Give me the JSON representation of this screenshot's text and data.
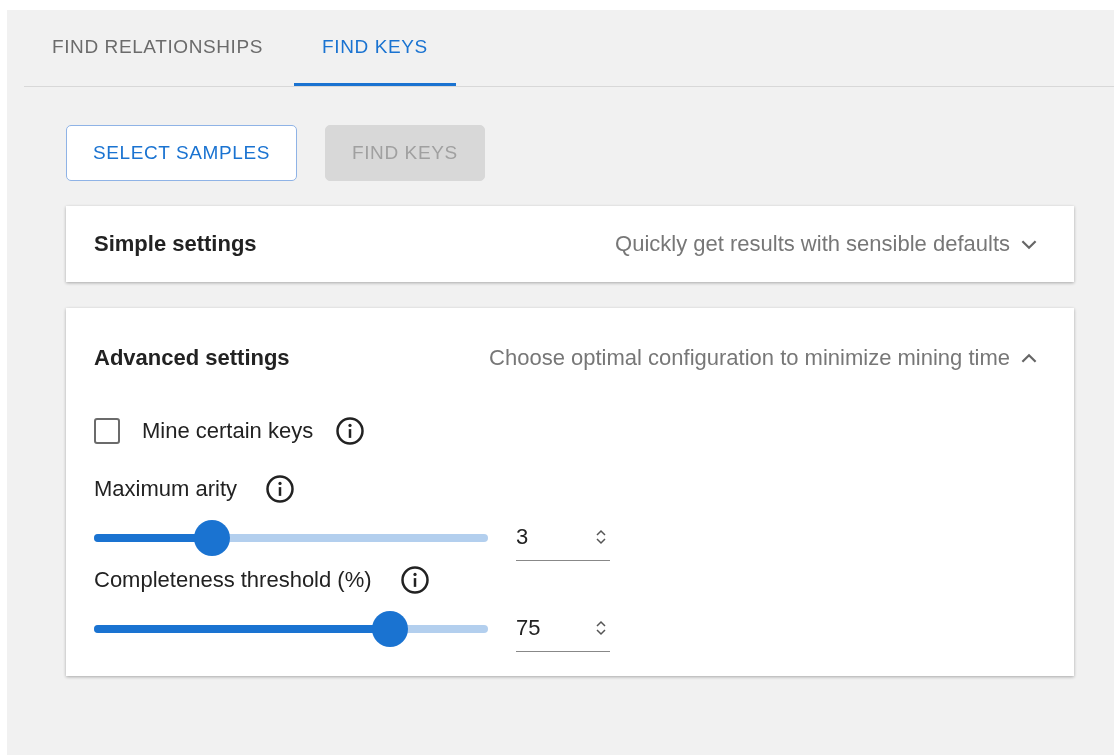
{
  "tabs": [
    {
      "label": "FIND RELATIONSHIPS",
      "selected": false
    },
    {
      "label": "FIND KEYS",
      "selected": true
    }
  ],
  "actions": [
    {
      "label": "SELECT SAMPLES",
      "disabled": false
    },
    {
      "label": "FIND KEYS",
      "disabled": true
    }
  ],
  "sections": [
    {
      "title": "Simple settings",
      "subtitle": "Quickly get results with sensible defaults",
      "expanded": false
    },
    {
      "title": "Advanced settings",
      "subtitle": "Choose optimal configuration to minimize mining time",
      "expanded": true,
      "settings": [
        {
          "kind": "checkbox",
          "label": "Mine certain keys",
          "checked": false
        },
        {
          "kind": "slider",
          "label": "Maximum arity",
          "level": 0.3,
          "value": "3"
        },
        {
          "kind": "slider",
          "label": "Completeness threshold (%)",
          "level": 0.75,
          "value": "75"
        }
      ]
    }
  ]
}
